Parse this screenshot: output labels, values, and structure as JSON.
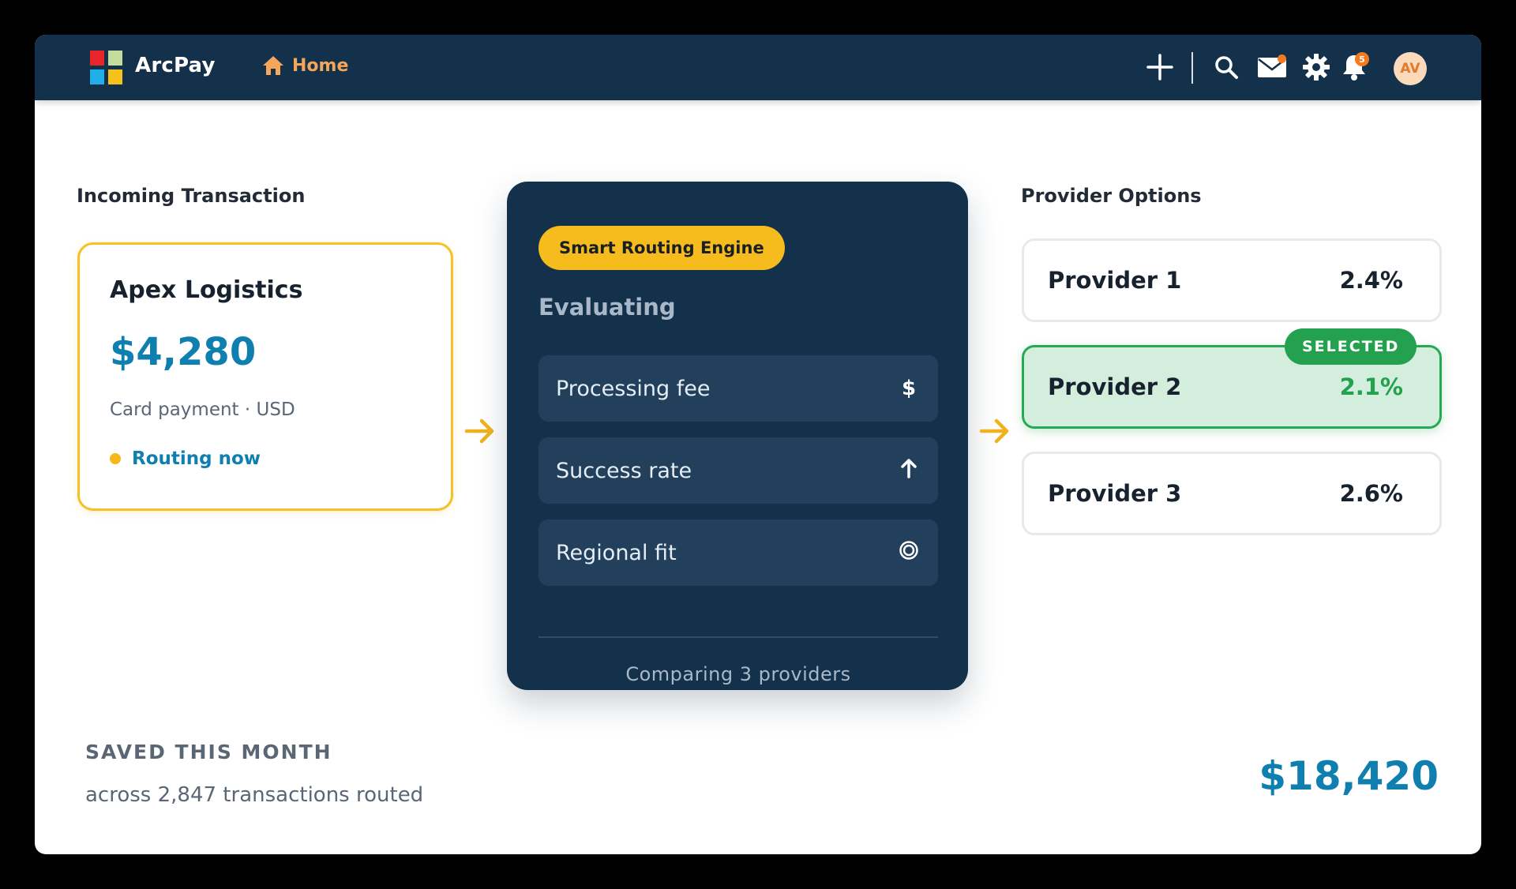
{
  "app": {
    "brand": "ArcPay",
    "home_label": "Home"
  },
  "topbar": {
    "icons": [
      "plus-icon",
      "search-icon",
      "mail-icon",
      "gear-icon",
      "bell-icon"
    ],
    "notification_count": "5",
    "avatar_initials": "AV"
  },
  "incoming": {
    "title": "Incoming Transaction",
    "merchant": "Apex Logistics",
    "amount": "$4,280",
    "meta": "Card payment · USD",
    "status": "Routing now"
  },
  "engine": {
    "badge": "Smart Routing Engine",
    "state": "Evaluating",
    "criteria": [
      {
        "label": "Processing fee",
        "icon": "dollar-icon"
      },
      {
        "label": "Success rate",
        "icon": "arrow-up-icon"
      },
      {
        "label": "Regional fit",
        "icon": "target-icon"
      }
    ],
    "footer": "Comparing 3 providers"
  },
  "providers": {
    "title": "Provider Options",
    "selected_tag": "SELECTED",
    "items": [
      {
        "name": "Provider 1",
        "rate": "2.4%",
        "selected": false
      },
      {
        "name": "Provider 2",
        "rate": "2.1%",
        "selected": true
      },
      {
        "name": "Provider 3",
        "rate": "2.6%",
        "selected": false
      }
    ]
  },
  "savings": {
    "label": "SAVED THIS MONTH",
    "subtext": "across 2,847 transactions routed",
    "amount": "$18,420"
  },
  "colors": {
    "navy": "#14314b",
    "accent_yellow": "#f6bc1d",
    "accent_blue": "#0f7fb0",
    "success_green": "#24a14e",
    "home_orange": "#f5a65b"
  }
}
